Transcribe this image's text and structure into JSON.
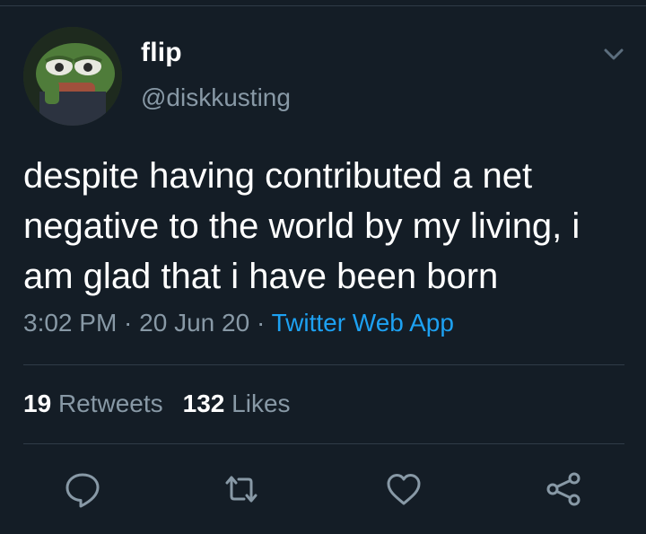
{
  "tweet": {
    "display_name": "flip",
    "handle": "@diskkusting",
    "text": "despite having contributed a net negative to the world by my living, i am glad that i have been born",
    "time": "3:02 PM",
    "date": "20 Jun 20",
    "source": "Twitter Web App",
    "separator": " · "
  },
  "stats": {
    "retweets_count": "19",
    "retweets_label": "Retweets",
    "likes_count": "132",
    "likes_label": "Likes"
  },
  "icons": {
    "menu": "chevron-down-icon",
    "reply": "reply-icon",
    "retweet": "retweet-icon",
    "like": "heart-icon",
    "share": "share-icon"
  },
  "colors": {
    "background": "#141d26",
    "text": "#ffffff",
    "secondary": "#8899a6",
    "link": "#1da1f2",
    "divider": "#2f3b47"
  }
}
